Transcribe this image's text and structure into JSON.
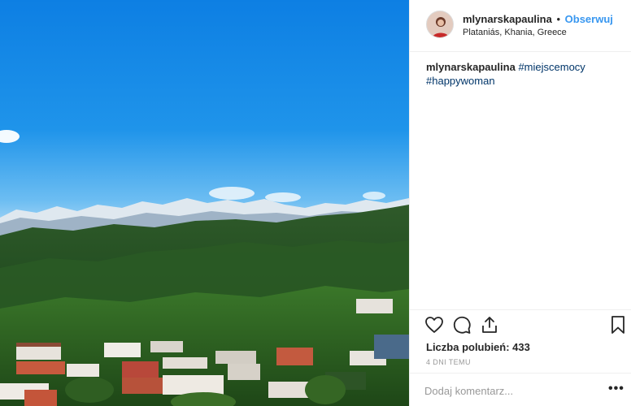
{
  "post": {
    "photo_icon": "landscape-photo"
  },
  "header": {
    "username": "mlynarskapaulina",
    "separator": "•",
    "follow_label": "Obserwuj",
    "location": "Plataniás, Khania, Greece"
  },
  "caption": {
    "username": "mlynarskapaulina",
    "tag1": "#miejscemocy",
    "tag2": "#happywoman"
  },
  "actions": {
    "like_icon": "heart-icon",
    "comment_icon": "comment-icon",
    "share_icon": "share-icon",
    "save_icon": "bookmark-icon"
  },
  "likes": {
    "text": "Liczba polubień: 433"
  },
  "time": {
    "text": "4 DNI TEMU"
  },
  "comment": {
    "placeholder": "Dodaj komentarz...",
    "more_label": "•••"
  },
  "colors": {
    "link": "#3897f0",
    "hashtag": "#003569",
    "sky": "#1a8be6"
  }
}
